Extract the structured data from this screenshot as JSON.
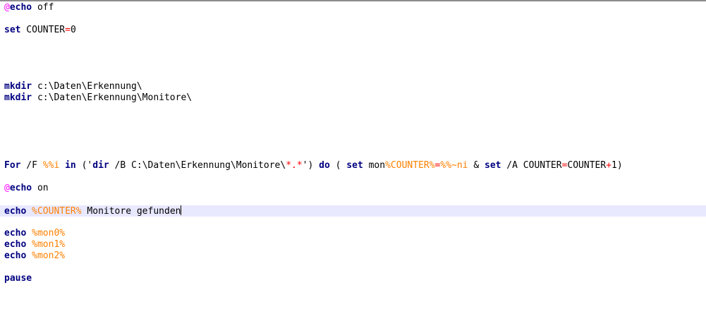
{
  "editor": {
    "lines": [
      [
        {
          "t": "at",
          "v": "@"
        },
        {
          "t": "kw",
          "v": "echo"
        },
        {
          "t": "txt",
          "v": " off"
        }
      ],
      [],
      [
        {
          "t": "kw",
          "v": "set"
        },
        {
          "t": "txt",
          "v": " COUNTER"
        },
        {
          "t": "op",
          "v": "="
        },
        {
          "t": "txt",
          "v": "0"
        }
      ],
      [],
      [],
      [],
      [],
      [
        {
          "t": "kw",
          "v": "mkdir"
        },
        {
          "t": "txt",
          "v": " c:\\Daten\\Erkennung\\"
        }
      ],
      [
        {
          "t": "kw",
          "v": "mkdir"
        },
        {
          "t": "txt",
          "v": " c:\\Daten\\Erkennung\\Monitore\\"
        }
      ],
      [],
      [],
      [],
      [],
      [],
      [
        {
          "t": "kw",
          "v": "For"
        },
        {
          "t": "txt",
          "v": " /F "
        },
        {
          "t": "var",
          "v": "%%i"
        },
        {
          "t": "txt",
          "v": " "
        },
        {
          "t": "kw",
          "v": "in"
        },
        {
          "t": "txt",
          "v": " ('"
        },
        {
          "t": "kw",
          "v": "dir"
        },
        {
          "t": "txt",
          "v": " /B C:\\Daten\\Erkennung\\Monitore\\"
        },
        {
          "t": "op",
          "v": "*.*"
        },
        {
          "t": "txt",
          "v": "') "
        },
        {
          "t": "kw",
          "v": "do"
        },
        {
          "t": "txt",
          "v": " ( "
        },
        {
          "t": "kw",
          "v": "set"
        },
        {
          "t": "txt",
          "v": " mon"
        },
        {
          "t": "var",
          "v": "%COUNTER%"
        },
        {
          "t": "op",
          "v": "="
        },
        {
          "t": "var",
          "v": "%%~ni"
        },
        {
          "t": "txt",
          "v": " & "
        },
        {
          "t": "kw",
          "v": "set"
        },
        {
          "t": "txt",
          "v": " /A COUNTER"
        },
        {
          "t": "op",
          "v": "="
        },
        {
          "t": "txt",
          "v": "COUNTER"
        },
        {
          "t": "op",
          "v": "+"
        },
        {
          "t": "txt",
          "v": "1)"
        }
      ],
      [],
      [
        {
          "t": "at",
          "v": "@"
        },
        {
          "t": "kw",
          "v": "echo"
        },
        {
          "t": "txt",
          "v": " on"
        }
      ],
      [],
      [
        {
          "t": "kw",
          "v": "echo"
        },
        {
          "t": "txt",
          "v": " "
        },
        {
          "t": "var",
          "v": "%COUNTER%"
        },
        {
          "t": "txt",
          "v": " Monitore gefunden"
        }
      ],
      [],
      [
        {
          "t": "kw",
          "v": "echo"
        },
        {
          "t": "txt",
          "v": " "
        },
        {
          "t": "var",
          "v": "%mon0%"
        }
      ],
      [
        {
          "t": "kw",
          "v": "echo"
        },
        {
          "t": "txt",
          "v": " "
        },
        {
          "t": "var",
          "v": "%mon1%"
        }
      ],
      [
        {
          "t": "kw",
          "v": "echo"
        },
        {
          "t": "txt",
          "v": " "
        },
        {
          "t": "var",
          "v": "%mon2%"
        }
      ],
      [],
      [
        {
          "t": "kw",
          "v": "pause"
        }
      ]
    ],
    "current_line": 18,
    "colors": {
      "keyword": "#000080",
      "at_sign": "#ff00ff",
      "variable": "#ff8000",
      "operator": "#ff0000",
      "current_line_bg": "#e8e8ff"
    }
  }
}
